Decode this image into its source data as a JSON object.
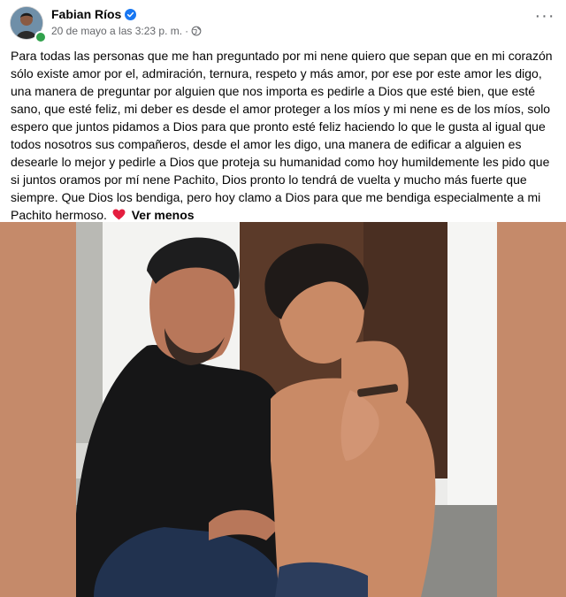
{
  "post": {
    "author": "Fabian Ríos",
    "timestamp": "20 de mayo a las 3:23 p. m.",
    "separator": "·",
    "privacy_icon": "globe-icon",
    "verified_icon": "verified-badge-icon",
    "body": "Para todas las personas que me han preguntado por mi nene quiero que sepan que en mi corazón sólo existe amor por el, admiración, ternura, respeto y más amor, por ese por este amor les digo, una manera de preguntar por alguien que nos importa es pedirle a Dios que esté bien, que esté sano, que esté feliz, mi deber es desde el amor proteger a los míos y mi nene es de los míos, solo espero que juntos pidamos a Dios para que pronto esté feliz haciendo lo que le gusta al igual que todos nosotros sus compañeros, desde el amor les digo, una manera de edificar a alguien es desearle lo mejor y pedirle a Dios que proteja su humanidad como hoy humildemente les pido que si juntos oramos por mí nene Pachito, Dios pronto lo tendrá de vuelta y mucho más fuerte que siempre. Que Dios los bendiga, pero hoy clamo a Dios para que me bendiga especialmente a mi Pachito hermoso.",
    "see_less": "Ver menos"
  },
  "colors": {
    "accent_blue": "#1877f2",
    "online_green": "#31a24c",
    "photo_bg": "#c58a6a",
    "heart": "#e41e3f"
  }
}
